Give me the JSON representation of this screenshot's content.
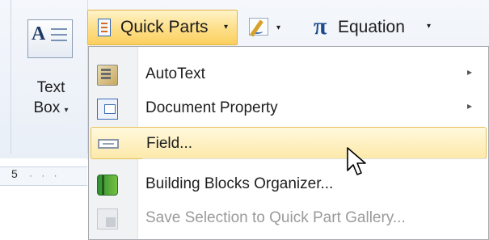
{
  "ribbon": {
    "textbox": {
      "line1": "Text",
      "line2": "Box",
      "arrow": "▾",
      "icon": "text-box-icon"
    },
    "quick_parts": {
      "label": "Quick Parts",
      "arrow": "▾",
      "icon": "quick-parts-icon"
    },
    "signature": {
      "arrow": "▾",
      "icon": "signature-line-icon"
    },
    "equation": {
      "symbol": "π",
      "label": "Equation",
      "arrow": "▾"
    }
  },
  "ruler": {
    "number": "5",
    "ticks": "· · ·"
  },
  "menu": {
    "items": [
      {
        "label": "AutoText",
        "has_submenu": true,
        "icon": "autotext-icon",
        "submenu_arrow": "▸"
      },
      {
        "label": "Document Property",
        "has_submenu": true,
        "icon": "document-property-icon",
        "submenu_arrow": "▸"
      },
      {
        "label": "Field...",
        "has_submenu": false,
        "icon": "field-icon",
        "state": "highlighted"
      },
      {
        "label": "Building Blocks Organizer...",
        "has_submenu": false,
        "icon": "building-blocks-icon"
      },
      {
        "label": "Save Selection to Quick Part Gallery...",
        "has_submenu": false,
        "icon": "save-selection-icon",
        "state": "disabled"
      }
    ]
  },
  "colors": {
    "hover_fill": "#fde9a9",
    "hover_border": "#e6c25c",
    "disabled_text": "#9a9a9a",
    "pi_blue": "#1e4b8e"
  }
}
